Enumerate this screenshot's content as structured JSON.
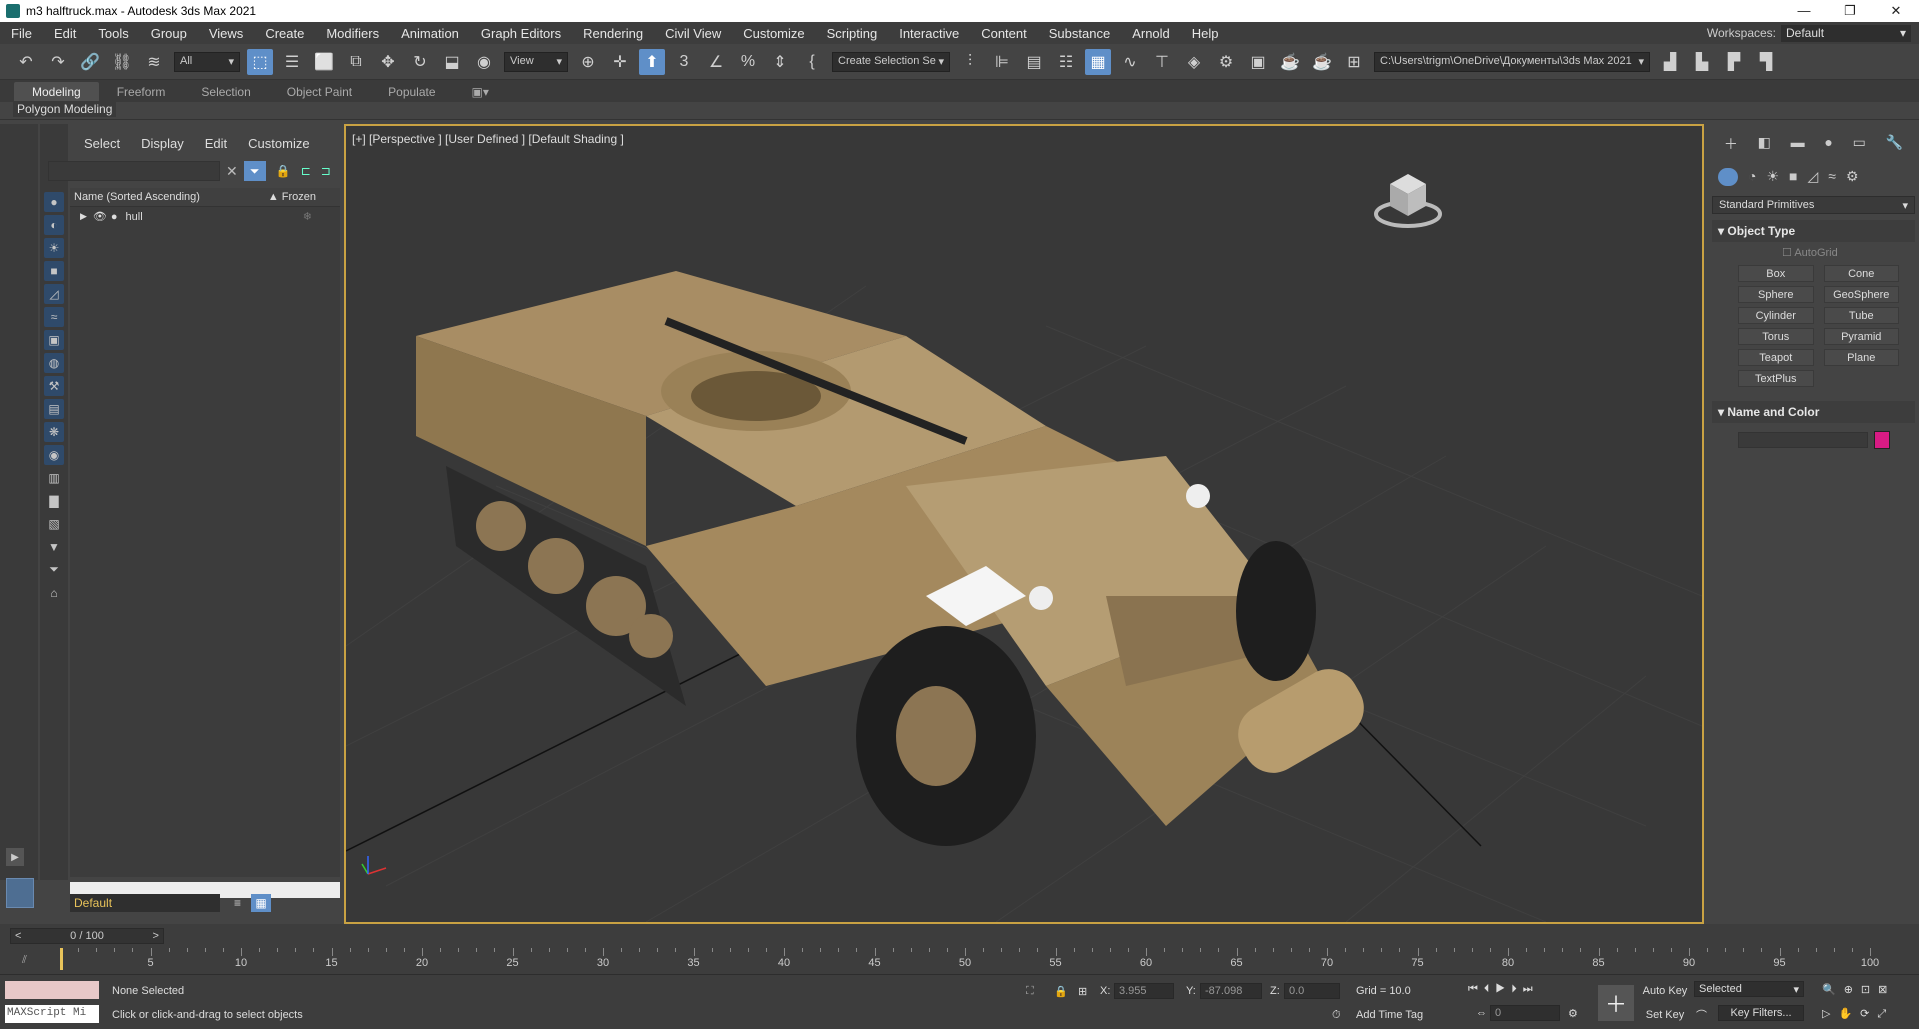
{
  "window": {
    "title": "m3 halftruck.max - Autodesk 3ds Max 2021"
  },
  "menu": {
    "items": [
      "File",
      "Edit",
      "Tools",
      "Group",
      "Views",
      "Create",
      "Modifiers",
      "Animation",
      "Graph Editors",
      "Rendering",
      "Civil View",
      "Customize",
      "Scripting",
      "Interactive",
      "Content",
      "Substance",
      "Arnold",
      "Help"
    ],
    "workspaces_label": "Workspaces:",
    "workspace_value": "Default"
  },
  "toolbar": {
    "selection_filter": "All",
    "coord_system": "View",
    "named_selection": "Create Selection Se",
    "project_path": "C:\\Users\\trigm\\OneDrive\\Документы\\3ds Max 2021"
  },
  "ribbon": {
    "tabs": [
      "Modeling",
      "Freeform",
      "Selection",
      "Object Paint",
      "Populate"
    ],
    "panel": "Polygon Modeling"
  },
  "scene_explorer": {
    "tabs": [
      "Select",
      "Display",
      "Edit",
      "Customize"
    ],
    "col_name": "Name (Sorted Ascending)",
    "col_frozen": "▲ Frozen",
    "items": [
      {
        "name": "hull"
      }
    ],
    "layer": "Default"
  },
  "viewport": {
    "label": "[+] [Perspective ] [User Defined ] [Default Shading ]"
  },
  "command_panel": {
    "category": "Standard Primitives",
    "object_type_title": "Object Type",
    "autogrid": "AutoGrid",
    "buttons": [
      "Box",
      "Cone",
      "Sphere",
      "GeoSphere",
      "Cylinder",
      "Tube",
      "Torus",
      "Pyramid",
      "Teapot",
      "Plane",
      "TextPlus"
    ],
    "name_color_title": "Name and Color",
    "color": "#d81b84"
  },
  "timeline": {
    "frame": "0 / 100",
    "ticks": [
      0,
      5,
      10,
      15,
      20,
      25,
      30,
      35,
      40,
      45,
      50,
      55,
      60,
      65,
      70,
      75,
      80,
      85,
      90,
      95,
      100
    ],
    "tick_labels": [
      "5",
      "10",
      "15",
      "20",
      "25",
      "30",
      "35",
      "40",
      "45",
      "50",
      "55",
      "60",
      "65",
      "70",
      "75",
      "80",
      "85",
      "90",
      "95",
      "100"
    ]
  },
  "status": {
    "maxscript": "MAXScript Mi",
    "selection": "None Selected",
    "prompt": "Click or click-and-drag to select objects",
    "x_label": "X:",
    "x_value": "3.955",
    "y_label": "Y:",
    "y_value": "-87.098",
    "z_label": "Z:",
    "z_value": "0.0",
    "grid": "Grid = 10.0",
    "add_time_tag": "Add Time Tag",
    "auto_key": "Auto Key",
    "set_key": "Set Key",
    "key_mode": "Selected",
    "frame_field": "0",
    "key_filters": "Key Filters..."
  }
}
